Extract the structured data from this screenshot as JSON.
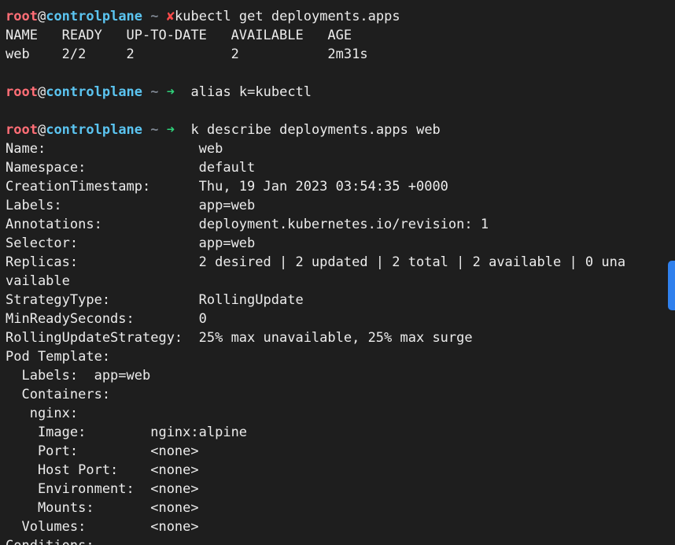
{
  "prompt": {
    "user": "root",
    "at": "@",
    "host": "controlplane",
    "dir": "~",
    "fail_symbol": "✘",
    "ok_symbol": "➜"
  },
  "commands": {
    "get": "kubectl get deployments.apps",
    "alias": "alias k=kubectl",
    "describe": "k describe deployments.apps web"
  },
  "get_output": {
    "header": "NAME   READY   UP-TO-DATE   AVAILABLE   AGE",
    "row": "web    2/2     2            2           2m31s"
  },
  "describe_output": [
    "Name:                   web",
    "Namespace:              default",
    "CreationTimestamp:      Thu, 19 Jan 2023 03:54:35 +0000",
    "Labels:                 app=web",
    "Annotations:            deployment.kubernetes.io/revision: 1",
    "Selector:               app=web",
    "Replicas:               2 desired | 2 updated | 2 total | 2 available | 0 una",
    "vailable",
    "StrategyType:           RollingUpdate",
    "MinReadySeconds:        0",
    "RollingUpdateStrategy:  25% max unavailable, 25% max surge",
    "Pod Template:",
    "  Labels:  app=web",
    "  Containers:",
    "   nginx:",
    "    Image:        nginx:alpine",
    "    Port:         <none>",
    "    Host Port:    <none>",
    "    Environment:  <none>",
    "    Mounts:       <none>",
    "  Volumes:        <none>",
    "Conditions:"
  ]
}
